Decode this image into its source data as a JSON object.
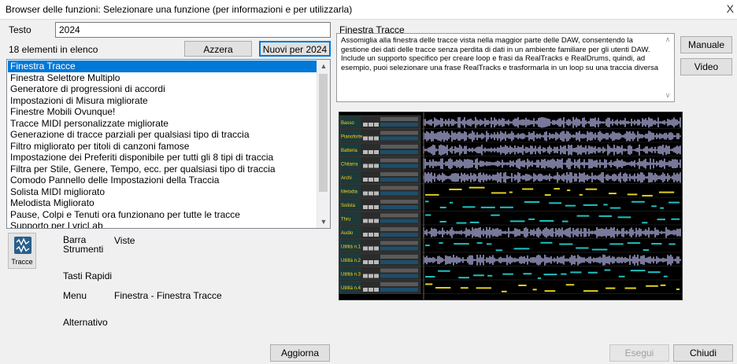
{
  "window": {
    "title": "Browser delle funzioni: Selezionare una funzione (per informazioni e per utilizzarla)",
    "close_glyph": "X"
  },
  "search": {
    "label": "Testo",
    "value": "2024"
  },
  "list_count": "18 elementi in elenco",
  "buttons": {
    "reset": "Azzera",
    "new_in": "Nuovi per 2024",
    "manual": "Manuale",
    "video": "Video",
    "update": "Aggiorna",
    "execute": "Esegui",
    "close": "Chiudi"
  },
  "features": [
    "Finestra Tracce",
    "Finestra Selettore Multiplo",
    "Generatore di progressioni di accordi",
    "Impostazioni di Misura migliorate",
    "Finestre Mobili Ovunque!",
    "Tracce MIDI personalizzate migliorate",
    "Generazione di tracce parziali per qualsiasi tipo di traccia",
    "Filtro migliorato per titoli di canzoni famose",
    "Impostazione dei Preferiti disponibile per tutti gli 8 tipi di traccia",
    "Filtra per Stile, Genere, Tempo, ecc. per qualsiasi tipo di traccia",
    "Comodo Pannello delle Impostazioni della Traccia",
    "Solista MIDI migliorato",
    "Melodista Migliorato",
    "Pause, Colpi e Tenuti ora funzionano per tutte le tracce",
    "Supporto per LyricLab"
  ],
  "selected_index": 0,
  "detail": {
    "heading": "Finestra Tracce",
    "description": "Assomiglia alla finestra delle tracce vista nella maggior parte delle DAW, consentendo la gestione dei dati delle tracce senza perdita di dati in un ambiente familiare per gli utenti DAW. Include un supporto specifico per creare loop e frasi da RealTracks e RealDrums, quindi, ad esempio, puoi selezionare una frase RealTracks e trasformarla in un loop su una traccia diversa"
  },
  "tool_icon": {
    "icon": "tracks-window-icon",
    "caption": "Tracce"
  },
  "info": {
    "toolbar_label": "Barra Strumenti",
    "toolbar_value": "Viste",
    "hotkeys_label": "Tasti Rapidi",
    "menu_label": "Menu",
    "menu_value": "Finestra - Finestra Tracce",
    "alt_label": "Alternativo"
  },
  "preview_tracks": [
    {
      "name": "Basso",
      "type": "audio",
      "color": "#c8c8ff"
    },
    {
      "name": "Pianoforte",
      "type": "audio",
      "color": "#c8c8ff"
    },
    {
      "name": "Batteria",
      "type": "audio",
      "color": "#c8c8ff"
    },
    {
      "name": "Chitarra",
      "type": "audio",
      "color": "#c8c8ff"
    },
    {
      "name": "Archi",
      "type": "audio",
      "color": "#c8c8ff"
    },
    {
      "name": "Melodia",
      "type": "midi",
      "color": "#e0d020"
    },
    {
      "name": "Solista",
      "type": "midi",
      "color": "#20c0c0"
    },
    {
      "name": "Thru",
      "type": "midi",
      "color": "#20c0c0"
    },
    {
      "name": "Audio",
      "type": "audio",
      "color": "#c8c8ff"
    },
    {
      "name": "Utilità n.1",
      "type": "midi",
      "color": "#20c0c0"
    },
    {
      "name": "Utilità n.2",
      "type": "audio",
      "color": "#c8c8ff"
    },
    {
      "name": "Utilità n.3",
      "type": "midi",
      "color": "#20c0c0"
    },
    {
      "name": "Utilità n.4",
      "type": "midi",
      "color": "#e0d020"
    }
  ]
}
